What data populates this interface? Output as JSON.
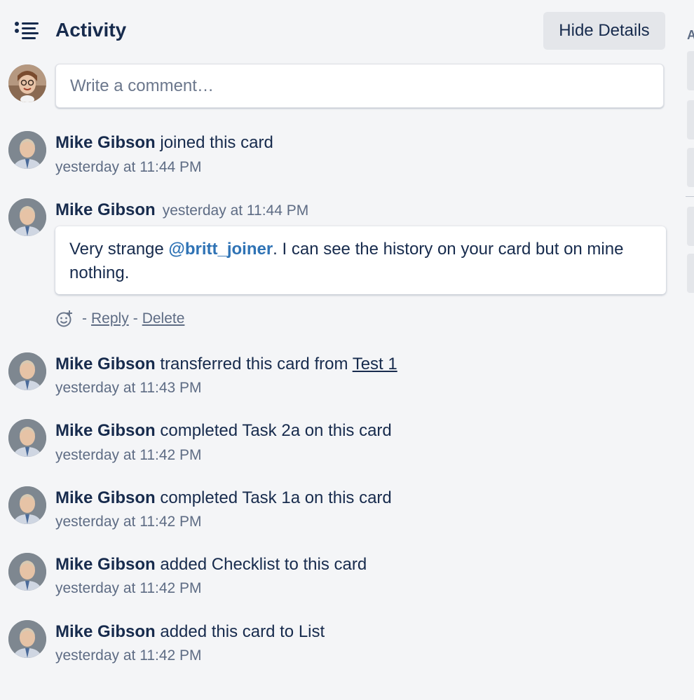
{
  "header": {
    "title": "Activity",
    "icon": "activity-list-icon",
    "hide_details_label": "Hide Details"
  },
  "comment_input": {
    "placeholder": "Write a comment…",
    "value": ""
  },
  "activities": [
    {
      "type": "action",
      "user": "Mike Gibson",
      "text": "joined this card",
      "timestamp": "yesterday at 11:44 PM"
    },
    {
      "type": "comment",
      "user": "Mike Gibson",
      "timestamp": "yesterday at 11:44 PM",
      "comment_prefix": "Very strange ",
      "mention": "@britt_joiner",
      "comment_suffix_line1": ". I can see the history on your card but on mine",
      "comment_suffix_line2": "nothing.",
      "actions": {
        "separator": "-",
        "reply_label": "Reply",
        "delete_label": "Delete",
        "reaction_icon": "add-reaction-icon"
      }
    },
    {
      "type": "action",
      "user": "Mike Gibson",
      "text": "transferred this card from",
      "link": "Test 1",
      "timestamp": "yesterday at 11:43 PM"
    },
    {
      "type": "action",
      "user": "Mike Gibson",
      "text": "completed Task 2a on this card",
      "timestamp": "yesterday at 11:42 PM"
    },
    {
      "type": "action",
      "user": "Mike Gibson",
      "text": "completed Task 1a on this card",
      "timestamp": "yesterday at 11:42 PM"
    },
    {
      "type": "action",
      "user": "Mike Gibson",
      "text": "added Checklist to this card",
      "timestamp": "yesterday at 11:42 PM"
    },
    {
      "type": "action",
      "user": "Mike Gibson",
      "text": "added this card to List",
      "timestamp": "yesterday at 11:42 PM"
    }
  ],
  "right_rail": {
    "partial_label": "A"
  }
}
